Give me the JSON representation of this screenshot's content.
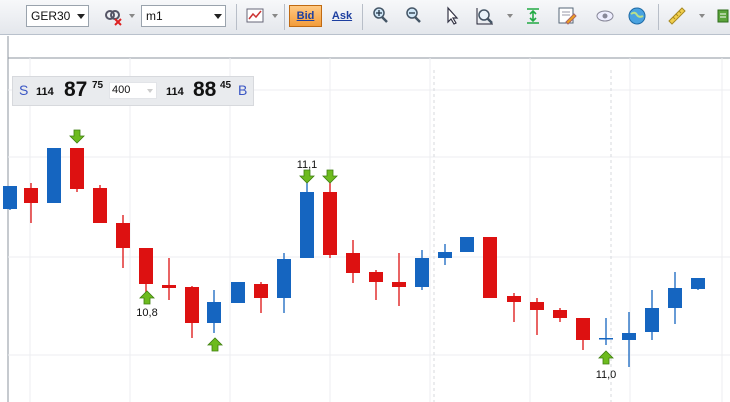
{
  "toolbar": {
    "symbol": "GER30",
    "timeframe": "m1",
    "bid_label": "Bid",
    "ask_label": "Ask"
  },
  "price_panel": {
    "sell_label": "S",
    "sell_prefix": "114",
    "sell_main": "87",
    "sell_sup": "75",
    "lot_size": "400",
    "buy_prefix": "114",
    "buy_main": "88",
    "buy_sup": "45",
    "buy_label": "B"
  },
  "colors": {
    "bull": "#1565c0",
    "bear": "#dd1111",
    "arrow": "#6dbb1e"
  },
  "chart_data": {
    "type": "candlestick",
    "annotations": [
      {
        "text": "10,8"
      },
      {
        "text": "11,1"
      },
      {
        "text": "11,0"
      }
    ]
  }
}
